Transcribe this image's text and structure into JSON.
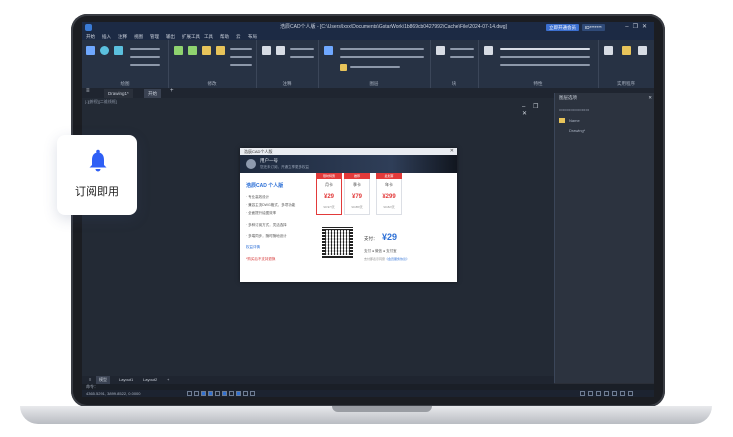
{
  "titlebar": {
    "title": "浩辰CAD个人版 - [C:\\Users\\lxxx\\Documents\\GstarWork\\1b869cb0427992\\Cache\\File\\2024-07-14.dwg]",
    "subscribe_btn": "立即开通会员",
    "user_btn": "ID*******"
  },
  "menu": [
    "开始",
    "插入",
    "注释",
    "视图",
    "管理",
    "输出",
    "扩展工具",
    "工具",
    "帮助",
    "云",
    "布局"
  ],
  "ribbon_groups": [
    "绘图",
    "修改",
    "注释",
    "图层",
    "块",
    "特性",
    "实用程序"
  ],
  "doc_tabs": [
    "Drawing1*",
    "开始"
  ],
  "view_label": "[-][俯视][二维线框]",
  "canvas_ctrls": "–  ❐  ✕",
  "right_panel": {
    "title": "图层选项",
    "rows": [
      "Name",
      "Drawing*"
    ]
  },
  "bottom_tabs": [
    "模型",
    "Layout1",
    "Layout2",
    "+"
  ],
  "cmd_prompt": "命令：",
  "status_coords": "4365.5291, 3899.8522, 0.0000",
  "dialog": {
    "title": "浩辰CAD个人版",
    "user_name": "用户一号",
    "user_sub": "您还未订阅，开通立享更多权益",
    "logo": "浩辰CAD 个人版",
    "features": [
      "· 专业高效设计",
      "· 兼容主流DWG格式，多项功能",
      "· 全面提升绘图效率",
      "· 多种订阅方式，灵活选择",
      "· 多端同步，随时随地设计"
    ],
    "link": "权益详情",
    "warning": "*购买后不支持退换",
    "plans": [
      {
        "name": "月卡",
        "price": "¥29",
        "avg": "¥0.97/天",
        "badge": "限时特惠"
      },
      {
        "name": "季卡",
        "price": "¥79",
        "avg": "¥0.88/天",
        "badge": "推荐"
      },
      {
        "name": "年卡",
        "price": "¥299",
        "avg": "¥0.82/天",
        "badge": "最划算"
      }
    ],
    "pay_label": "支付：",
    "pay_amount": "¥29",
    "pay_methods": "支付 ● 微信 ● 支付宝",
    "pay_agree": "支付即表示同意",
    "pay_agree_link": "《会员服务协议》"
  },
  "notice": {
    "label": "订阅即用"
  },
  "colors": {
    "accent": "#2c6fd6",
    "price_red": "#e23a3a",
    "bell_blue": "#2f5ff5"
  }
}
